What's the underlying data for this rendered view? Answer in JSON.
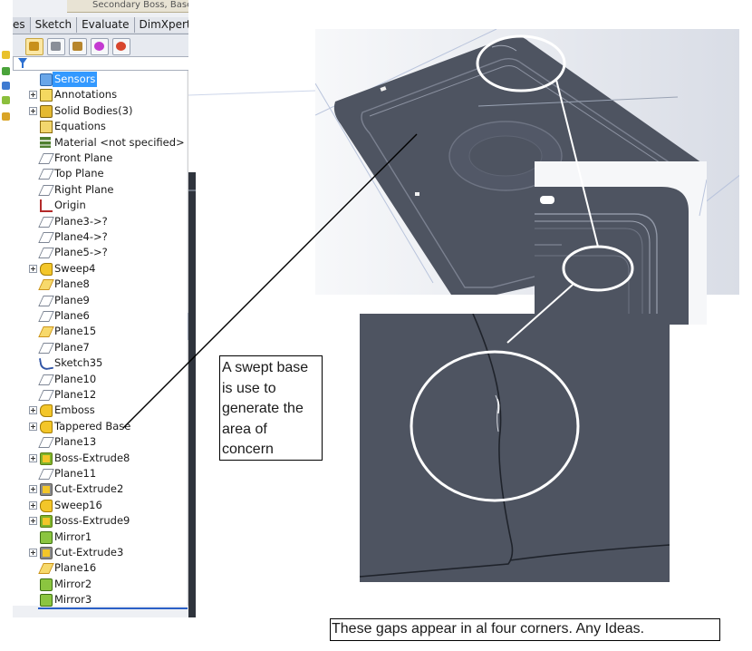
{
  "feature_manager": {
    "top_clipped_text": "Secondary Boss, Base",
    "tabs": [
      {
        "label": "es"
      },
      {
        "label": "Sketch"
      },
      {
        "label": "Evaluate"
      },
      {
        "label": "DimXpert"
      }
    ],
    "more_glyph": "»",
    "toolbar_icons": [
      "feature-manager-icon",
      "property-manager-icon",
      "configuration-manager-icon",
      "dimxpert-manager-icon",
      "display-manager-icon"
    ],
    "filter_icon": "filter-icon",
    "tree": [
      {
        "label": "Sensors",
        "icon": "sensor-icon",
        "expandable": false,
        "selected": true
      },
      {
        "label": "Annotations",
        "icon": "annotation-icon",
        "expandable": true
      },
      {
        "label": "Solid Bodies(3)",
        "icon": "solid-bodies-icon",
        "expandable": true
      },
      {
        "label": "Equations",
        "icon": "equations-icon",
        "expandable": false
      },
      {
        "label": "Material <not specified>",
        "icon": "material-icon",
        "expandable": false
      },
      {
        "label": "Front Plane",
        "icon": "plane-icon",
        "expandable": false
      },
      {
        "label": "Top Plane",
        "icon": "plane-icon",
        "expandable": false
      },
      {
        "label": "Right Plane",
        "icon": "plane-icon",
        "expandable": false
      },
      {
        "label": "Origin",
        "icon": "origin-icon",
        "expandable": false
      },
      {
        "label": "Plane3->?",
        "icon": "plane-icon",
        "expandable": false
      },
      {
        "label": "Plane4->?",
        "icon": "plane-icon",
        "expandable": false
      },
      {
        "label": "Plane5->?",
        "icon": "plane-icon",
        "expandable": false
      },
      {
        "label": "Sweep4",
        "icon": "sweep-icon",
        "expandable": true
      },
      {
        "label": "Plane8",
        "icon": "plane-highlight-icon",
        "expandable": false
      },
      {
        "label": "Plane9",
        "icon": "plane-icon",
        "expandable": false
      },
      {
        "label": "Plane6",
        "icon": "plane-icon",
        "expandable": false
      },
      {
        "label": "Plane15",
        "icon": "plane-highlight-icon",
        "expandable": false
      },
      {
        "label": "Plane7",
        "icon": "plane-icon",
        "expandable": false
      },
      {
        "label": "Sketch35",
        "icon": "sketch-icon",
        "expandable": false
      },
      {
        "label": "Plane10",
        "icon": "plane-icon",
        "expandable": false
      },
      {
        "label": "Plane12",
        "icon": "plane-icon",
        "expandable": false
      },
      {
        "label": "Emboss",
        "icon": "sweep-icon",
        "expandable": true
      },
      {
        "label": "Tappered Base",
        "icon": "sweep-icon",
        "expandable": true
      },
      {
        "label": "Plane13",
        "icon": "plane-icon",
        "expandable": false
      },
      {
        "label": "Boss-Extrude8",
        "icon": "boss-extrude-icon",
        "expandable": true
      },
      {
        "label": "Plane11",
        "icon": "plane-icon",
        "expandable": false
      },
      {
        "label": "Cut-Extrude2",
        "icon": "cut-extrude-icon",
        "expandable": true
      },
      {
        "label": "Sweep16",
        "icon": "sweep-icon",
        "expandable": true
      },
      {
        "label": "Boss-Extrude9",
        "icon": "boss-extrude-icon",
        "expandable": true
      },
      {
        "label": "Mirror1",
        "icon": "mirror-icon",
        "expandable": false
      },
      {
        "label": "Cut-Extrude3",
        "icon": "cut-extrude-icon",
        "expandable": true
      },
      {
        "label": "Plane16",
        "icon": "plane-highlight-icon",
        "expandable": false
      },
      {
        "label": "Mirror2",
        "icon": "mirror-icon",
        "expandable": false
      },
      {
        "label": "Mirror3",
        "icon": "mirror-icon",
        "expandable": false
      }
    ]
  },
  "annotations": {
    "callout_swept_base": "A swept base is use to generate the area of concern",
    "callout_gaps": "These gaps  appear  in al four corners.  Any Ideas."
  },
  "colors": {
    "selection": "#3399ff",
    "model_gray": "#4e5461",
    "highlight_circle": "#ffffff"
  }
}
